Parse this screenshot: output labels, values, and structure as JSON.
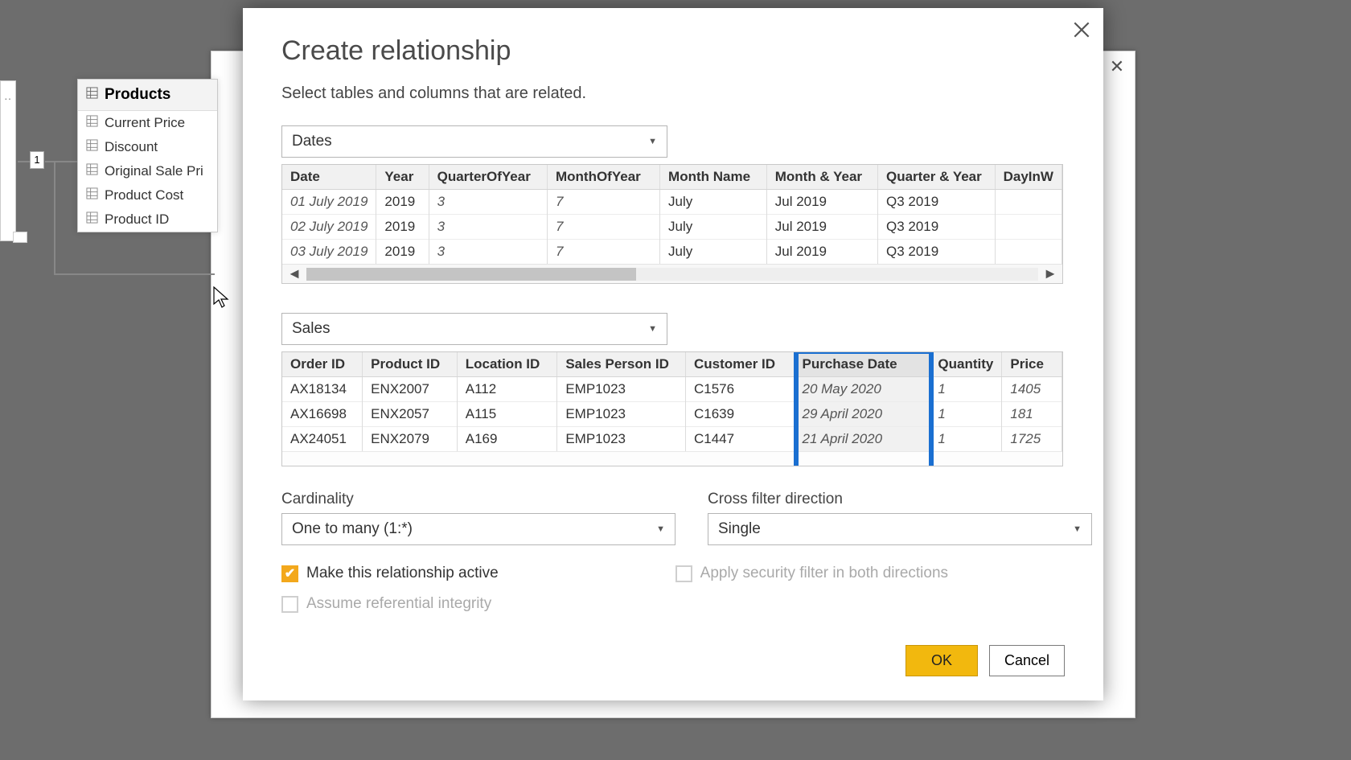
{
  "background_panel": {
    "close_glyph": "✕"
  },
  "products_card": {
    "title": "Products",
    "fields": [
      "Current Price",
      "Discount",
      "Original Sale Pri",
      "Product Cost",
      "Product ID"
    ]
  },
  "link_label": "1",
  "dialog": {
    "title": "Create relationship",
    "subtitle": "Select tables and columns that are related.",
    "table1_selector": "Dates",
    "table2_selector": "Sales",
    "dates_table": {
      "headers": [
        "Date",
        "Year",
        "QuarterOfYear",
        "MonthOfYear",
        "Month Name",
        "Month & Year",
        "Quarter & Year",
        "DayInW"
      ],
      "rows": [
        [
          "01 July 2019",
          "2019",
          "3",
          "7",
          "July",
          "Jul 2019",
          "Q3 2019",
          ""
        ],
        [
          "02 July 2019",
          "2019",
          "3",
          "7",
          "July",
          "Jul 2019",
          "Q3 2019",
          ""
        ],
        [
          "03 July 2019",
          "2019",
          "3",
          "7",
          "July",
          "Jul 2019",
          "Q3 2019",
          ""
        ]
      ]
    },
    "sales_table": {
      "headers": [
        "Order ID",
        "Product ID",
        "Location ID",
        "Sales Person ID",
        "Customer ID",
        "Purchase Date",
        "Quantity",
        "Price"
      ],
      "highlighted_column_index": 5,
      "rows": [
        [
          "AX18134",
          "ENX2007",
          "A112",
          "EMP1023",
          "C1576",
          "20 May 2020",
          "1",
          "1405"
        ],
        [
          "AX16698",
          "ENX2057",
          "A115",
          "EMP1023",
          "C1639",
          "29 April 2020",
          "1",
          "181"
        ],
        [
          "AX24051",
          "ENX2079",
          "A169",
          "EMP1023",
          "C1447",
          "21 April 2020",
          "1",
          "1725"
        ]
      ]
    },
    "cardinality": {
      "label": "Cardinality",
      "value": "One to many (1:*)"
    },
    "cross_filter": {
      "label": "Cross filter direction",
      "value": "Single"
    },
    "checkboxes": {
      "active": {
        "label": "Make this relationship active",
        "checked": true,
        "enabled": true
      },
      "security": {
        "label": "Apply security filter in both directions",
        "checked": false,
        "enabled": false
      },
      "referential": {
        "label": "Assume referential integrity",
        "checked": false,
        "enabled": false
      }
    },
    "ok_label": "OK",
    "cancel_label": "Cancel"
  }
}
